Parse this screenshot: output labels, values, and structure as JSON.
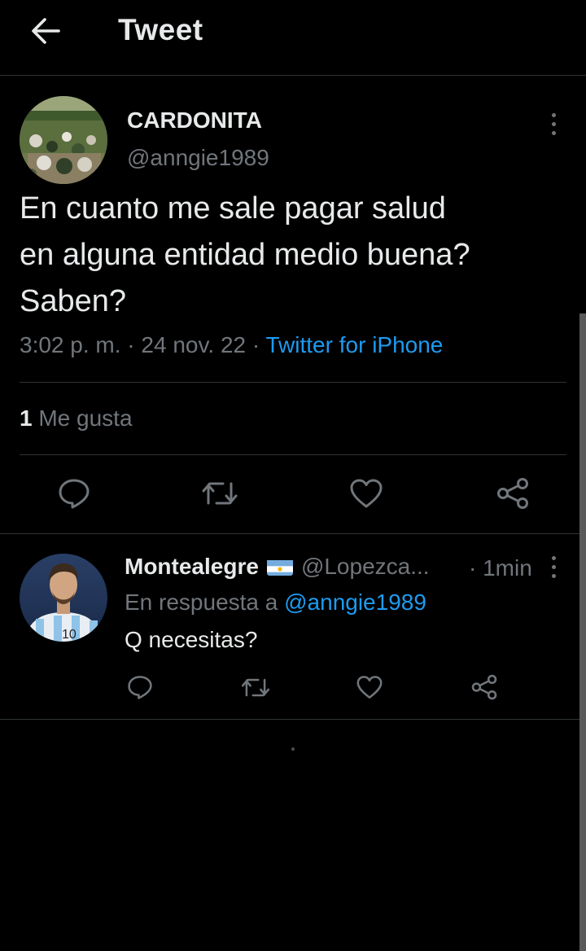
{
  "header": {
    "title": "Tweet",
    "back_icon": "arrow-left-icon"
  },
  "main_tweet": {
    "display_name": "CARDONITA",
    "handle": "@anngie1989",
    "text": "En cuanto me sale pagar salud\nen alguna entidad medio buena?\nSaben?",
    "time": "3:02 p. m.",
    "date": "24 nov. 22",
    "separator": "·",
    "source": "Twitter for iPhone",
    "likes_count": "1",
    "likes_label": "Me gusta",
    "actions": [
      "reply-icon",
      "retweet-icon",
      "like-icon",
      "share-icon"
    ]
  },
  "reply": {
    "display_name": "Montealegre",
    "flag": "argentina-flag-icon",
    "handle": "@Lopezca...",
    "time": "· 1min",
    "reply_prefix": "En respuesta a",
    "reply_mention": "@anngie1989",
    "text": "Q necesitas?",
    "actions": [
      "reply-icon",
      "retweet-icon",
      "like-icon",
      "share-icon"
    ]
  },
  "colors": {
    "background": "#000000",
    "text": "#e7e9ea",
    "muted": "#71767b",
    "accent": "#1d9bf0",
    "divider": "#2f3336"
  }
}
